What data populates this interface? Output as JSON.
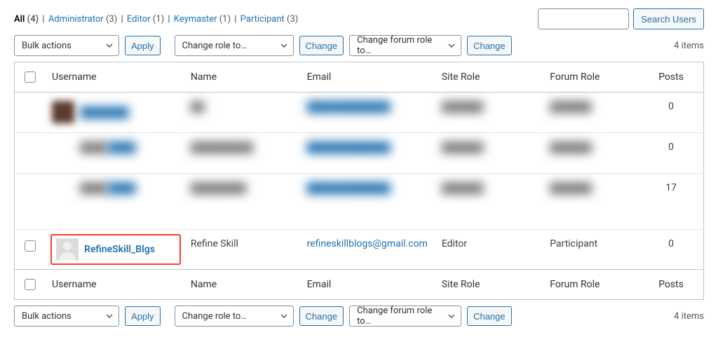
{
  "filters": {
    "all_label": "All",
    "all_count": "(4)",
    "admin_label": "Administrator",
    "admin_count": "(3)",
    "editor_label": "Editor",
    "editor_count": "(1)",
    "keymaster_label": "Keymaster",
    "keymaster_count": "(1)",
    "participant_label": "Participant",
    "participant_count": "(3)"
  },
  "search": {
    "placeholder": "",
    "button": "Search Users"
  },
  "controls": {
    "bulk_label": "Bulk actions",
    "apply_label": "Apply",
    "change_role_label": "Change role to…",
    "change_btn": "Change",
    "change_forum_role_label": "Change forum role to…",
    "items_count": "4 items"
  },
  "columns": {
    "username": "Username",
    "name": "Name",
    "email": "Email",
    "site_role": "Site Role",
    "forum_role": "Forum Role",
    "posts": "Posts"
  },
  "blurred_rows": [
    {
      "posts": "0"
    },
    {
      "posts": "0"
    },
    {
      "posts": "17"
    }
  ],
  "featured_user": {
    "username": "RefineSkill_Blgs",
    "name": "Refine Skill",
    "email": "refineskillblogs@gmail.com",
    "site_role": "Editor",
    "forum_role": "Participant",
    "posts": "0"
  }
}
